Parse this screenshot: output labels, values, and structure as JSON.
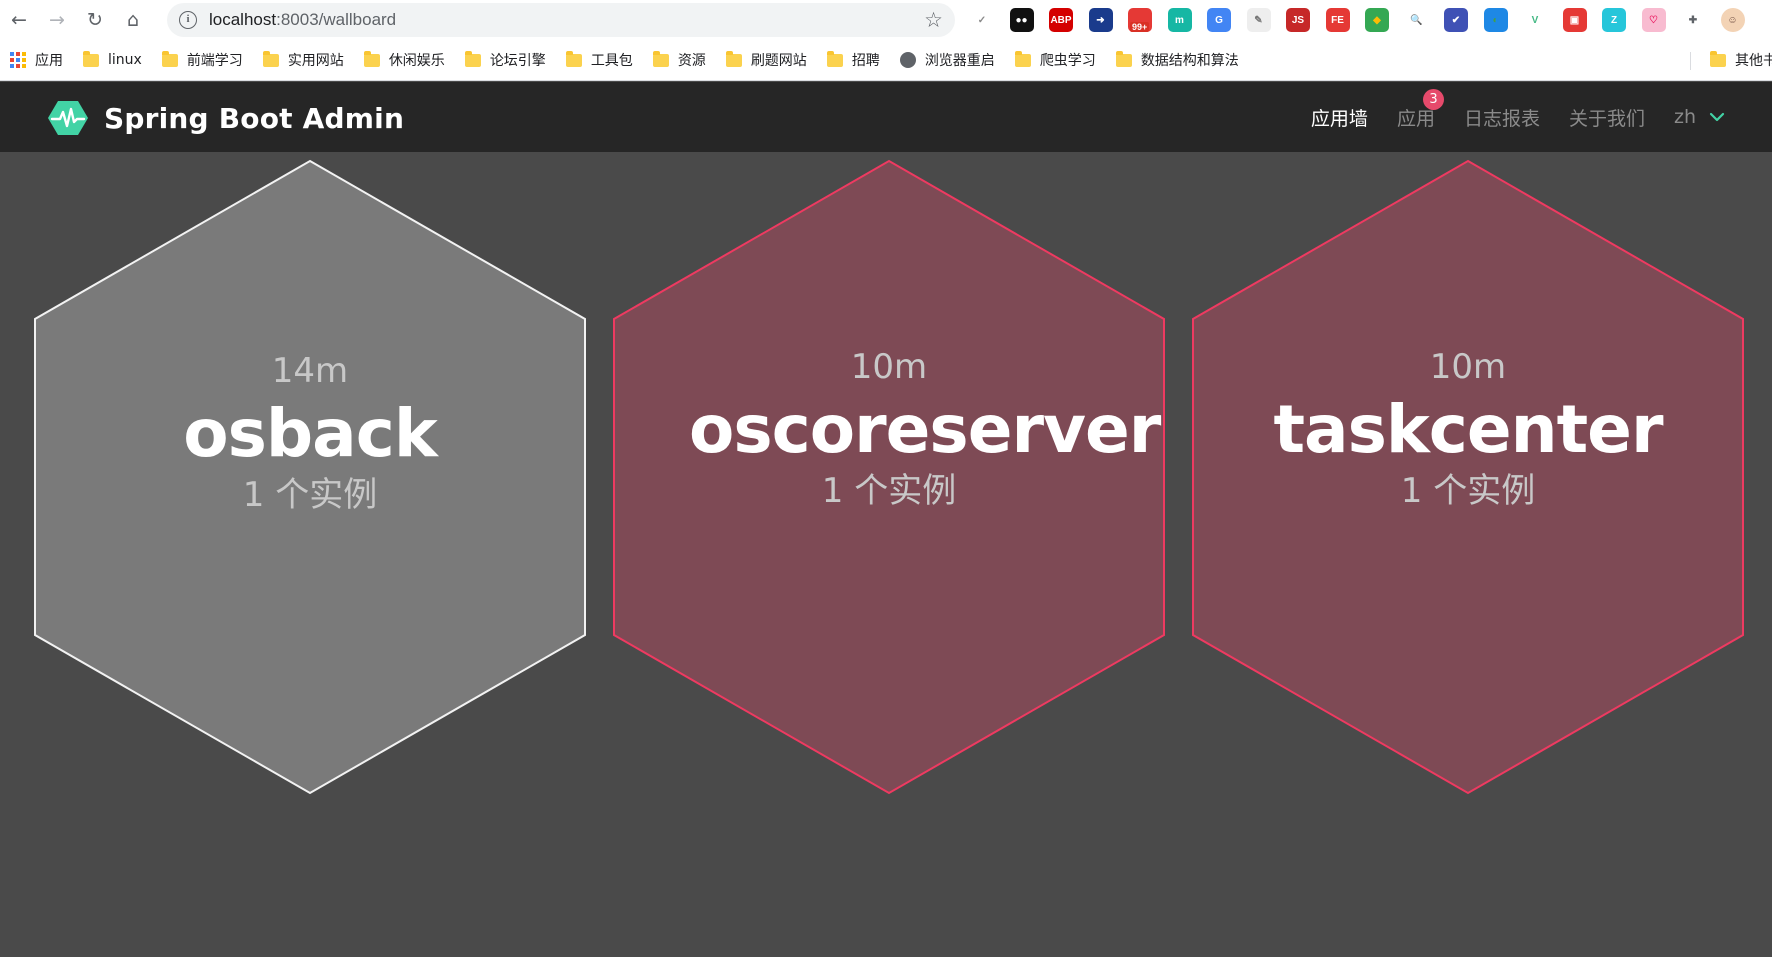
{
  "browser": {
    "url_host": "localhost",
    "url_rest": ":8003/wallboard",
    "extensions": [
      {
        "name": "check-ext-icon",
        "label": "✓",
        "color": "#ffffff",
        "fg": "#8a8a8a"
      },
      {
        "name": "tampermonkey-ext-icon",
        "label": "●●",
        "color": "#111111",
        "fg": "#ffffff"
      },
      {
        "name": "adblock-ext-icon",
        "label": "ABP",
        "color": "#d40000",
        "fg": "#ffffff"
      },
      {
        "name": "share-ext-icon",
        "label": "➜",
        "color": "#1a3b8c",
        "fg": "#ffffff"
      },
      {
        "name": "notify-ext-icon",
        "label": "",
        "color": "#e53935",
        "fg": "#ffffff",
        "badge": "99+"
      },
      {
        "name": "m-ext-icon",
        "label": "m",
        "color": "#16b7a4",
        "fg": "#ffffff"
      },
      {
        "name": "translate-ext-icon",
        "label": "G",
        "color": "#4285f4",
        "fg": "#ffffff"
      },
      {
        "name": "pencil-ext-icon",
        "label": "✎",
        "color": "#eeeeee",
        "fg": "#777777"
      },
      {
        "name": "js-ext-icon",
        "label": "JS",
        "color": "#c62828",
        "fg": "#ffffff"
      },
      {
        "name": "fe-ext-icon",
        "label": "FE",
        "color": "#e53935",
        "fg": "#ffffff"
      },
      {
        "name": "chrome-ext-icon",
        "label": "◆",
        "color": "#34a853",
        "fg": "#fbbc05"
      },
      {
        "name": "search-ext-icon",
        "label": "🔍",
        "color": "#ffffff",
        "fg": "#1565c0"
      },
      {
        "name": "verified-ext-icon",
        "label": "✔",
        "color": "#3f51b5",
        "fg": "#ffffff"
      },
      {
        "name": "globe-ext-icon",
        "label": "◐",
        "color": "#1e88e5",
        "fg": "#43a047"
      },
      {
        "name": "vue-ext-icon",
        "label": "V",
        "color": "#ffffff",
        "fg": "#42b883"
      },
      {
        "name": "cube-ext-icon",
        "label": "▣",
        "color": "#e53935",
        "fg": "#ffffff"
      },
      {
        "name": "zh-ext-icon",
        "label": "Z",
        "color": "#26c6da",
        "fg": "#ffffff"
      },
      {
        "name": "pig-ext-icon",
        "label": "♡",
        "color": "#f8bbd0",
        "fg": "#e91e63"
      },
      {
        "name": "puzzle-ext-icon",
        "label": "✚",
        "color": "#ffffff",
        "fg": "#5f6368"
      },
      {
        "name": "profile-avatar-icon",
        "label": "☺",
        "color": "#f3d3b5",
        "fg": "#6d4c41"
      }
    ],
    "bookmarks": [
      "应用",
      "linux",
      "前端学习",
      "实用网站",
      "休闲娱乐",
      "论坛引擎",
      "工具包",
      "资源",
      "刷题网站",
      "招聘",
      "浏览器重启",
      "爬虫学习",
      "数据结构和算法"
    ],
    "other_bookmarks": "其他书"
  },
  "app": {
    "brand": "Spring Boot Admin",
    "nav": {
      "wallboard": "应用墙",
      "applications": "应用",
      "applications_badge": "3",
      "journal": "日志报表",
      "about": "关于我们",
      "language": "zh"
    }
  },
  "colors": {
    "header_bg": "#262626",
    "page_bg": "#4a4a4a",
    "brand_green": "#42d3a5",
    "hex_up_fill": "#7a7a7a",
    "hex_up_stroke": "#f2f2f2",
    "hex_down_fill": "#7e4a55",
    "hex_down_stroke": "#ee3a61"
  },
  "wallboard": {
    "applications": [
      {
        "name": "osback",
        "time": "14m",
        "instances": "1 个实例",
        "status": "up"
      },
      {
        "name": "oscoreserver",
        "time": "10m",
        "instances": "1 个实例",
        "status": "down"
      },
      {
        "name": "taskcenter",
        "time": "10m",
        "instances": "1 个实例",
        "status": "down"
      }
    ]
  }
}
